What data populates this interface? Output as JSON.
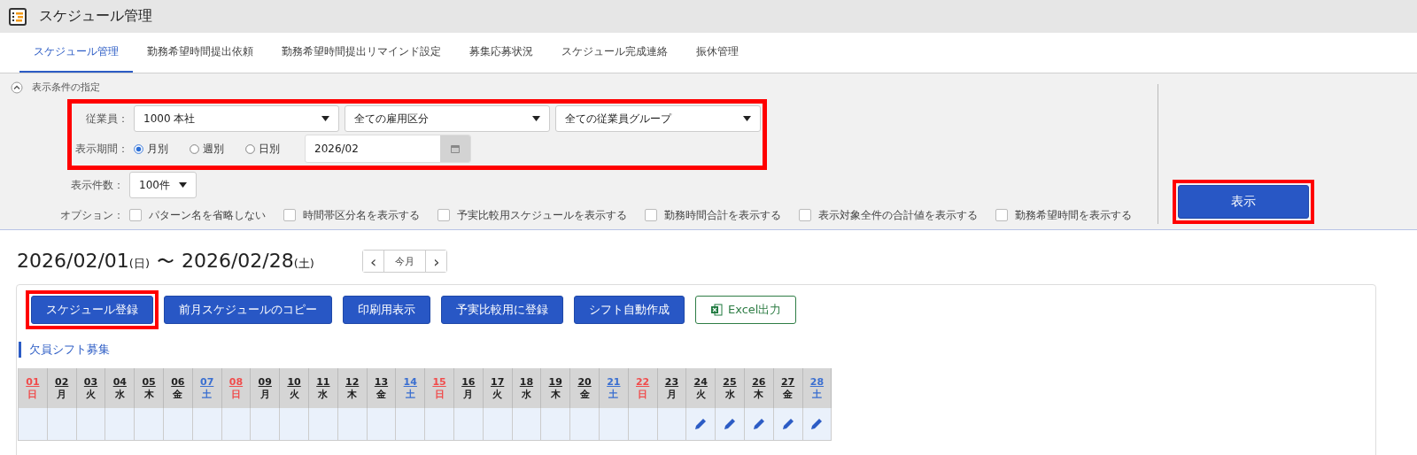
{
  "window": {
    "title": "スケジュール管理"
  },
  "tabs": [
    {
      "label": "スケジュール管理",
      "selected": true
    },
    {
      "label": "勤務希望時間提出依頼",
      "selected": false
    },
    {
      "label": "勤務希望時間提出リマインド設定",
      "selected": false
    },
    {
      "label": "募集応募状況",
      "selected": false
    },
    {
      "label": "スケジュール完成連絡",
      "selected": false
    },
    {
      "label": "振休管理",
      "selected": false
    }
  ],
  "filter": {
    "title": "表示条件の指定",
    "expanded": true,
    "employee": {
      "label": "従業員：",
      "selects": [
        "1000 本社",
        "全ての雇用区分",
        "全ての従業員グループ"
      ],
      "highlighted": true
    },
    "period": {
      "label": "表示期間：",
      "options": [
        {
          "label": "月別",
          "selected": true
        },
        {
          "label": "週別",
          "selected": false
        },
        {
          "label": "日別",
          "selected": false
        }
      ],
      "value": "2026/02"
    },
    "count": {
      "label": "表示件数：",
      "value": "100件"
    },
    "options": {
      "label": "オプション：",
      "items": [
        {
          "label": "パターン名を省略しない",
          "checked": false
        },
        {
          "label": "時間帯区分名を表示する",
          "checked": false
        },
        {
          "label": "予実比較用スケジュールを表示する",
          "checked": false
        },
        {
          "label": "勤務時間合計を表示する",
          "checked": false
        },
        {
          "label": "表示対象全件の合計値を表示する",
          "checked": false
        },
        {
          "label": "勤務希望時間を表示する",
          "checked": false
        }
      ]
    },
    "submit": {
      "label": "表示",
      "highlighted": true
    }
  },
  "range": {
    "start": "2026/02/01",
    "start_day": "(日)",
    "separator": "〜",
    "end": "2026/02/28",
    "end_day": "(土)"
  },
  "nav": {
    "prev": "‹",
    "today": "今月",
    "next": "›"
  },
  "actions": [
    {
      "label": "スケジュール登録",
      "kind": "primary",
      "highlighted": true
    },
    {
      "label": "前月スケジュールのコピー",
      "kind": "primary",
      "highlighted": false
    },
    {
      "label": "印刷用表示",
      "kind": "primary",
      "highlighted": false
    },
    {
      "label": "予実比較用に登録",
      "kind": "primary",
      "highlighted": false
    },
    {
      "label": "シフト自動作成",
      "kind": "primary",
      "highlighted": false
    },
    {
      "label": "Excel出力",
      "kind": "excel",
      "highlighted": false
    }
  ],
  "section_title": "欠員シフト募集",
  "days": [
    {
      "day": "01",
      "weekday": "日",
      "kind": "sunday",
      "editable": false
    },
    {
      "day": "02",
      "weekday": "月",
      "kind": "weekday",
      "editable": false
    },
    {
      "day": "03",
      "weekday": "火",
      "kind": "weekday",
      "editable": false
    },
    {
      "day": "04",
      "weekday": "水",
      "kind": "weekday",
      "editable": false
    },
    {
      "day": "05",
      "weekday": "木",
      "kind": "weekday",
      "editable": false
    },
    {
      "day": "06",
      "weekday": "金",
      "kind": "weekday",
      "editable": false
    },
    {
      "day": "07",
      "weekday": "土",
      "kind": "saturday",
      "editable": false
    },
    {
      "day": "08",
      "weekday": "日",
      "kind": "sunday",
      "editable": false
    },
    {
      "day": "09",
      "weekday": "月",
      "kind": "weekday",
      "editable": false
    },
    {
      "day": "10",
      "weekday": "火",
      "kind": "weekday",
      "editable": false
    },
    {
      "day": "11",
      "weekday": "水",
      "kind": "weekday",
      "editable": false
    },
    {
      "day": "12",
      "weekday": "木",
      "kind": "weekday",
      "editable": false
    },
    {
      "day": "13",
      "weekday": "金",
      "kind": "weekday",
      "editable": false
    },
    {
      "day": "14",
      "weekday": "土",
      "kind": "saturday",
      "editable": false
    },
    {
      "day": "15",
      "weekday": "日",
      "kind": "sunday",
      "editable": false
    },
    {
      "day": "16",
      "weekday": "月",
      "kind": "weekday",
      "editable": false
    },
    {
      "day": "17",
      "weekday": "火",
      "kind": "weekday",
      "editable": false
    },
    {
      "day": "18",
      "weekday": "水",
      "kind": "weekday",
      "editable": false
    },
    {
      "day": "19",
      "weekday": "木",
      "kind": "weekday",
      "editable": false
    },
    {
      "day": "20",
      "weekday": "金",
      "kind": "weekday",
      "editable": false
    },
    {
      "day": "21",
      "weekday": "土",
      "kind": "saturday",
      "editable": false
    },
    {
      "day": "22",
      "weekday": "日",
      "kind": "sunday",
      "editable": false
    },
    {
      "day": "23",
      "weekday": "月",
      "kind": "weekday",
      "editable": false
    },
    {
      "day": "24",
      "weekday": "火",
      "kind": "weekday",
      "editable": true
    },
    {
      "day": "25",
      "weekday": "水",
      "kind": "weekday",
      "editable": true
    },
    {
      "day": "26",
      "weekday": "木",
      "kind": "weekday",
      "editable": true
    },
    {
      "day": "27",
      "weekday": "金",
      "kind": "weekday",
      "editable": true
    },
    {
      "day": "28",
      "weekday": "土",
      "kind": "saturday",
      "editable": true
    }
  ]
}
